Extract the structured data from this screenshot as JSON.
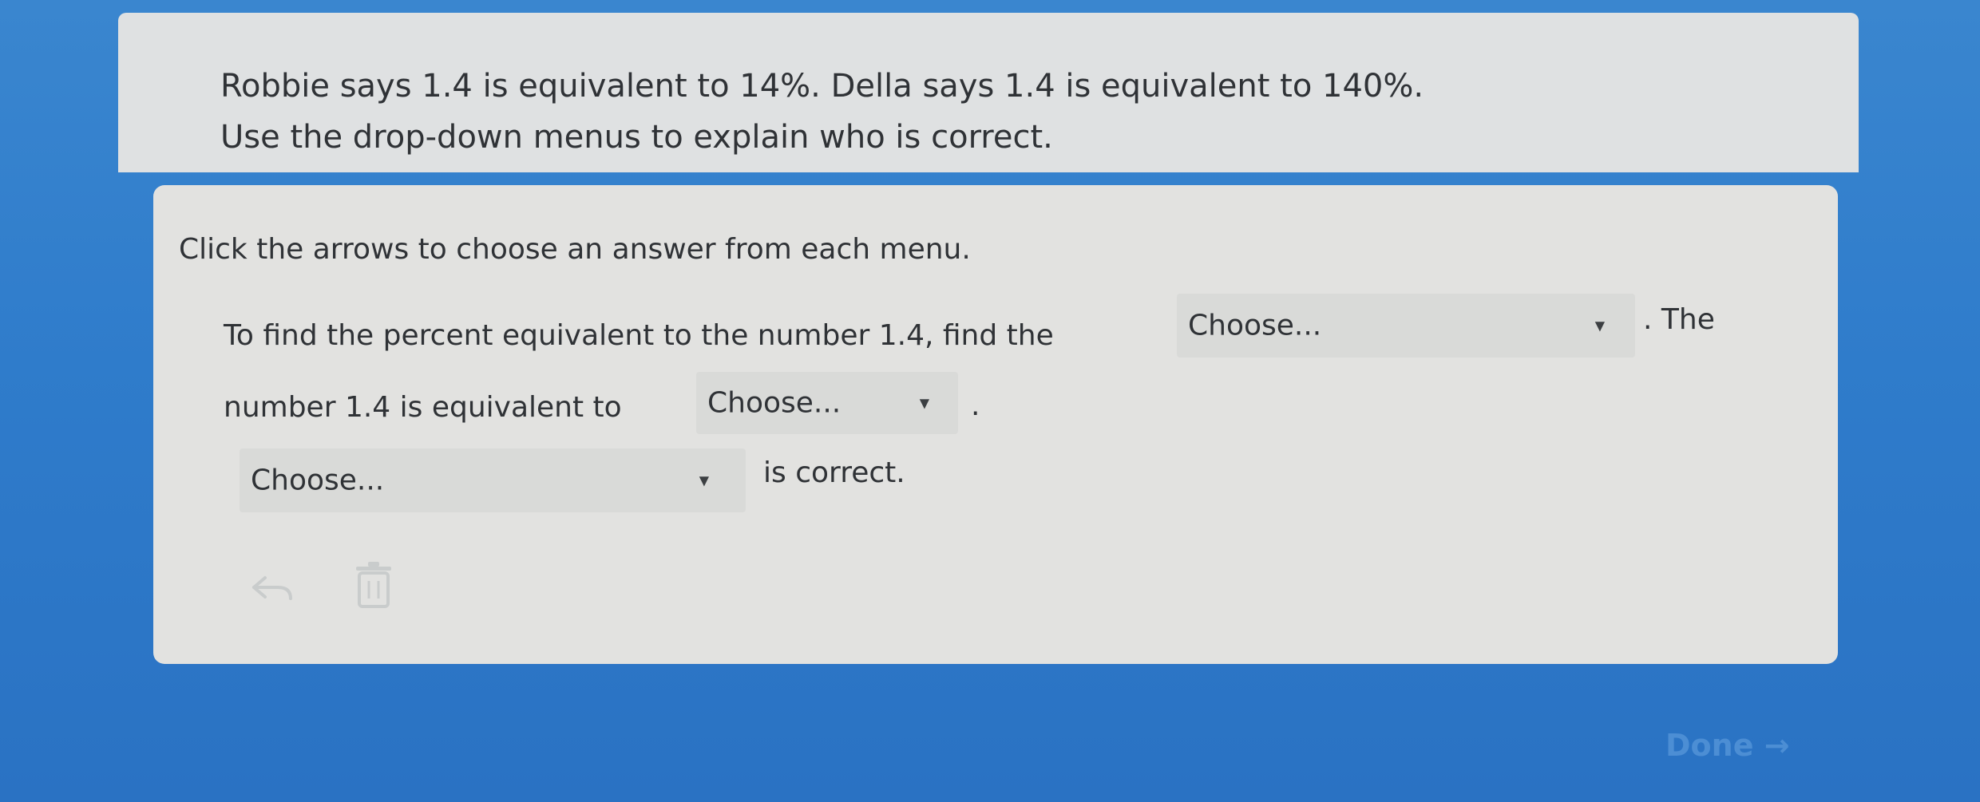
{
  "question": {
    "line1": "Robbie says 1.4 is equivalent to 14%. Della says 1.4 is equivalent to 140%.",
    "line2": "Use the drop-down menus to explain who is correct."
  },
  "answer": {
    "instruction": "Click the arrows to choose an answer from each menu.",
    "sentence1_prefix": "To find the percent equivalent to the number 1.4, find the",
    "sentence1_suffix": ". The",
    "sentence2_prefix": "number 1.4 is equivalent to",
    "sentence2_suffix": ".",
    "sentence3_suffix": "is correct.",
    "dropdown1": {
      "value": "Choose..."
    },
    "dropdown2": {
      "value": "Choose..."
    },
    "dropdown3": {
      "value": "Choose..."
    },
    "arrow_glyph": "▼"
  },
  "tools": {
    "undo_icon": "undo-icon",
    "trash_icon": "trash-icon"
  },
  "footer": {
    "done_label": "Done →"
  }
}
